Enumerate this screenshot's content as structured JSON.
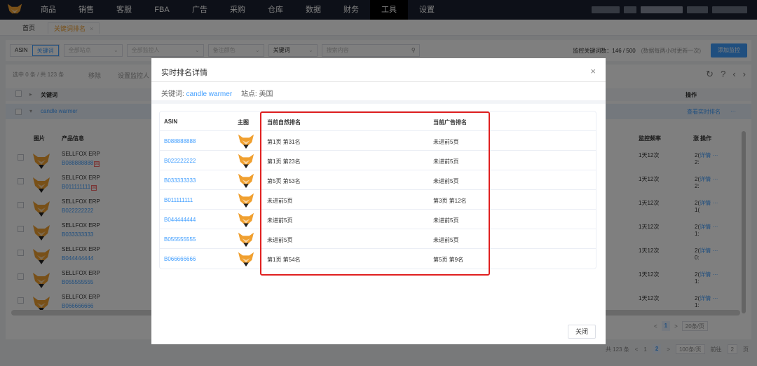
{
  "nav": {
    "items": [
      "商品",
      "销售",
      "客服",
      "FBA",
      "广告",
      "采购",
      "仓库",
      "数据",
      "财务",
      "工具",
      "设置"
    ],
    "active_index": 9,
    "bg_color": "#1b2130"
  },
  "tabs": {
    "home": "首页",
    "current": "关键词排名",
    "close": "×"
  },
  "filters": {
    "asin": "ASIN",
    "keyword": "关键词",
    "site_placeholder": "全部站点",
    "monitor_placeholder": "全部监控人",
    "color_placeholder": "备注颜色",
    "type_select": "关键词",
    "search_placeholder": "搜索内容",
    "stats": "监控关键词数：146 / 500",
    "stats_note": "(数据每两小时更新一次)",
    "add_button": "添加监控"
  },
  "toolbar": {
    "selected_info": "选中 0 条 / 共 123 条",
    "remove": "移除",
    "set_monitor": "设置监控人"
  },
  "group_header": {
    "keyword_col": "关键词",
    "ops_col": "操作"
  },
  "keyword_row": {
    "keyword": "candle warmer",
    "view_rank": "查看实时排名",
    "more": "···"
  },
  "columns": {
    "image": "图片",
    "product": "产品信息",
    "frequency": "监控频率",
    "ops": "操作",
    "ops_prefix": "涨"
  },
  "products": [
    {
      "name": "SELLFOX ERP",
      "asin": "B088888888",
      "flag": "図",
      "freq": "1天12次",
      "trunc1": "2(",
      "trunc2": "2:",
      "detail": "详情",
      "more": "···"
    },
    {
      "name": "SELLFOX ERP",
      "asin": "B011111111",
      "flag": "図",
      "freq": "1天12次",
      "trunc1": "2(",
      "trunc2": "2:",
      "detail": "详情",
      "more": "···"
    },
    {
      "name": "SELLFOX ERP",
      "asin": "B022222222",
      "flag": "",
      "freq": "1天12次",
      "trunc1": "2(",
      "trunc2": "1(",
      "detail": "详情",
      "more": "···"
    },
    {
      "name": "SELLFOX ERP",
      "asin": "B033333333",
      "flag": "",
      "freq": "1天12次",
      "trunc1": "2(",
      "trunc2": "1:",
      "detail": "详情",
      "more": "···"
    },
    {
      "name": "SELLFOX ERP",
      "asin": "B044444444",
      "flag": "",
      "freq": "1天12次",
      "trunc1": "2(",
      "trunc2": "0:",
      "detail": "详情",
      "more": "···"
    },
    {
      "name": "SELLFOX ERP",
      "asin": "B055555555",
      "flag": "",
      "freq": "1天12次",
      "trunc1": "2(",
      "trunc2": "1:",
      "detail": "详情",
      "more": "···"
    },
    {
      "name": "SELLFOX ERP",
      "asin": "B066666666",
      "flag": "",
      "freq": "1天12次",
      "trunc1": "2(",
      "trunc2": "1:",
      "detail": "详情",
      "more": "···"
    }
  ],
  "inner_pagination": {
    "prev": "<",
    "page": "1",
    "next": ">",
    "size": "20条/页"
  },
  "bottom_pagination": {
    "total": "共 123 条",
    "prev": "<",
    "pages": [
      "1",
      "2"
    ],
    "current": "2",
    "next": ">",
    "size": "100条/页",
    "goto_label": "前往",
    "goto_value": "2",
    "page_suffix": "页"
  },
  "modal": {
    "title": "实时排名详情",
    "close": "×",
    "keyword_label": "关键词:",
    "keyword": "candle warmer",
    "site_label": "站点:",
    "site": "美国",
    "headers": {
      "asin": "ASIN",
      "image": "主图",
      "natural": "当前自然排名",
      "ad": "当前广告排名"
    },
    "rows": [
      {
        "asin": "B088888888",
        "natural": "第1页 第31名",
        "ad": "未进前5页"
      },
      {
        "asin": "B022222222",
        "natural": "第1页 第23名",
        "ad": "未进前5页"
      },
      {
        "asin": "B033333333",
        "natural": "第5页 第53名",
        "ad": "未进前5页"
      },
      {
        "asin": "B011111111",
        "natural": "未进前5页",
        "ad": "第3页 第12名"
      },
      {
        "asin": "B044444444",
        "natural": "未进前5页",
        "ad": "未进前5页"
      },
      {
        "asin": "B055555555",
        "natural": "未进前5页",
        "ad": "未进前5页"
      },
      {
        "asin": "B066666666",
        "natural": "第1页 第54名",
        "ad": "第5页 第9名"
      }
    ],
    "close_button": "关闭",
    "highlight_color": "#e02020",
    "accent_color": "#409eff"
  }
}
